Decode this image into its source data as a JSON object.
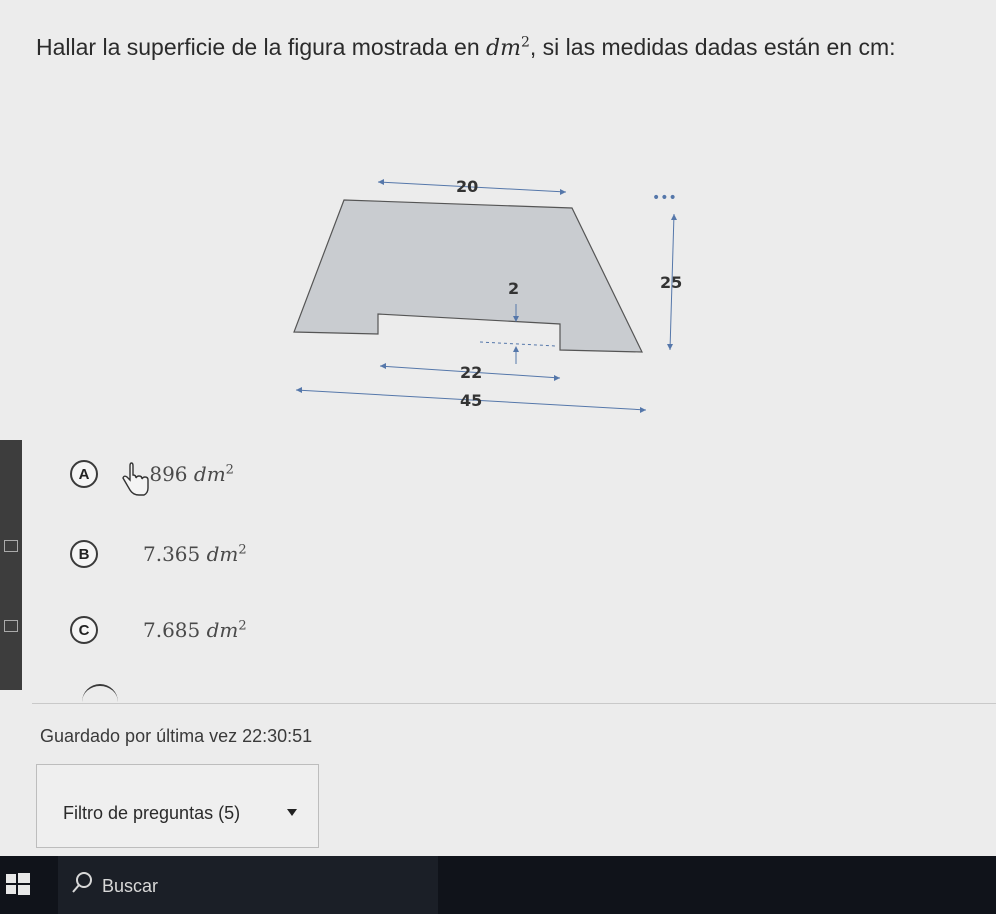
{
  "question": {
    "prefix": "Hallar la superficie de la figura mostrada en ",
    "unit": "dm",
    "exp": "2",
    "suffix": ", si las medidas dadas están en cm:"
  },
  "figure": {
    "top_width": "20",
    "height": "25",
    "notch_depth": "2",
    "notch_width": "22",
    "base_width": "45"
  },
  "options": [
    {
      "letter": "A",
      "value": ".896 ",
      "unit": "dm",
      "exp": "2"
    },
    {
      "letter": "B",
      "value": "7.365 ",
      "unit": "dm",
      "exp": "2"
    },
    {
      "letter": "C",
      "value": "7.685 ",
      "unit": "dm",
      "exp": "2"
    }
  ],
  "status": {
    "saved": "Guardado por última vez 22:30:51"
  },
  "filter": {
    "label": "Filtro de preguntas (5)"
  },
  "taskbar": {
    "search_label": "Buscar"
  }
}
